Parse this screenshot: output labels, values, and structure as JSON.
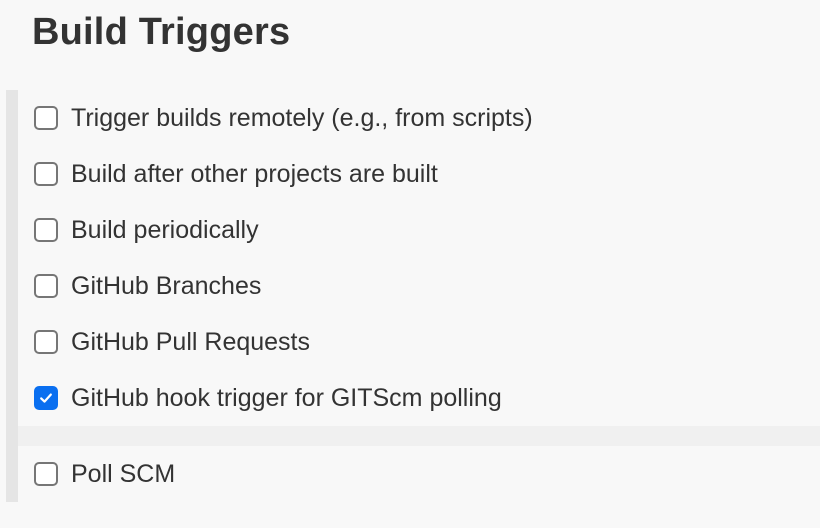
{
  "section": {
    "title": "Build Triggers"
  },
  "triggers": [
    {
      "label": "Trigger builds remotely (e.g., from scripts)",
      "checked": false
    },
    {
      "label": "Build after other projects are built",
      "checked": false
    },
    {
      "label": "Build periodically",
      "checked": false
    },
    {
      "label": "GitHub Branches",
      "checked": false
    },
    {
      "label": "GitHub Pull Requests",
      "checked": false
    },
    {
      "label": "GitHub hook trigger for GITScm polling",
      "checked": true
    },
    {
      "label": "Poll SCM",
      "checked": false
    }
  ],
  "icons": {
    "check": "checkmark-icon"
  },
  "colors": {
    "checked_fill": "#0a6ff0",
    "checkbox_border": "#767676",
    "text": "#333333"
  }
}
